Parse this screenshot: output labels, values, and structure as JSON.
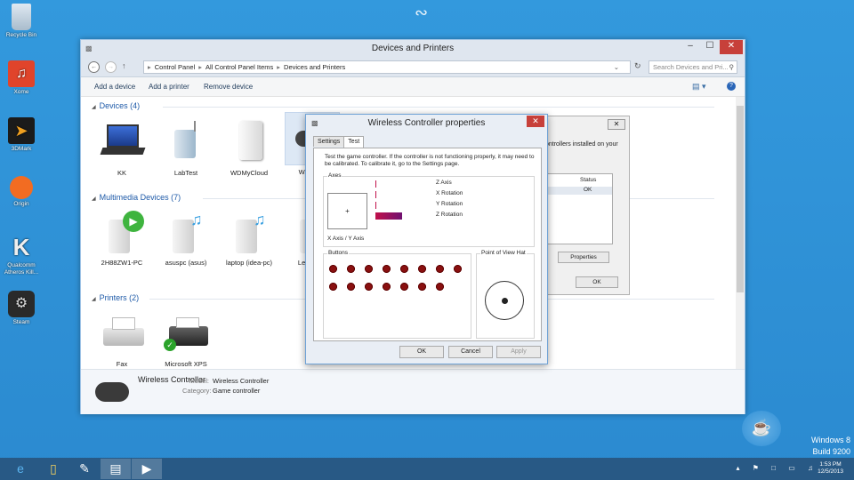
{
  "desktop": {
    "icons": [
      {
        "label": "Recycle Bin"
      },
      {
        "label": "Xome"
      },
      {
        "label": "3DMark"
      },
      {
        "label": "Origin"
      },
      {
        "label": "Qualcomm Atheros Kill..."
      },
      {
        "label": "Steam"
      }
    ],
    "watermark_line1": "Windows 8",
    "watermark_line2": "Build 9200"
  },
  "window": {
    "title": "Devices and Printers",
    "breadcrumb": [
      "Control Panel",
      "All Control Panel Items",
      "Devices and Printers"
    ],
    "search_placeholder": "Search Devices and Pri...",
    "commands": [
      "Add a device",
      "Add a printer",
      "Remove device"
    ],
    "sections": [
      {
        "title": "Devices (4)",
        "items": [
          "KK",
          "LabTest",
          "WDMyCloud",
          "W... Co..."
        ]
      },
      {
        "title": "Multimedia Devices (7)",
        "items": [
          "2H88ZW1-PC",
          "asuspc (asus)",
          "laptop (idea-pc)",
          "Lenov..."
        ]
      },
      {
        "title": "Printers (2)",
        "items": [
          "Fax",
          "Microsoft XPS"
        ]
      }
    ],
    "details": {
      "name": "Wireless Controller",
      "model_key": "Model:",
      "model_value": "Wireless Controller",
      "category_key": "Category:",
      "category_value": "Game controller"
    }
  },
  "bg_dialog": {
    "text": "ontrollers installed on your",
    "status_header": "Status",
    "status_value": "OK",
    "properties_btn": "Properties",
    "ok_btn": "OK"
  },
  "dialog": {
    "title": "Wireless Controller properties",
    "tabs": [
      "Settings",
      "Test"
    ],
    "instructions": "Test the game controller.  If the controller is not functioning properly, it may need to be calibrated.  To calibrate it, go to the Settings page.",
    "axes_label": "Axes",
    "xy_label": "X Axis / Y Axis",
    "xy_marker": "+",
    "axis_labels": [
      "Z Axis",
      "X Rotation",
      "Y Rotation",
      "Z Rotation"
    ],
    "axis_levels": [
      0.0,
      0.0,
      0.0,
      1.0
    ],
    "buttons_label": "Buttons",
    "button_count": 15,
    "pov_label": "Point of View Hat",
    "ok": "OK",
    "cancel": "Cancel",
    "apply": "Apply"
  },
  "taskbar": {
    "time": "1:53 PM",
    "date": "12/5/2013"
  },
  "colors": {
    "accent": "#1e5aa8",
    "close": "#c7403a",
    "button_dot": "#8a1010",
    "rotation_bar": "#b0104a"
  }
}
